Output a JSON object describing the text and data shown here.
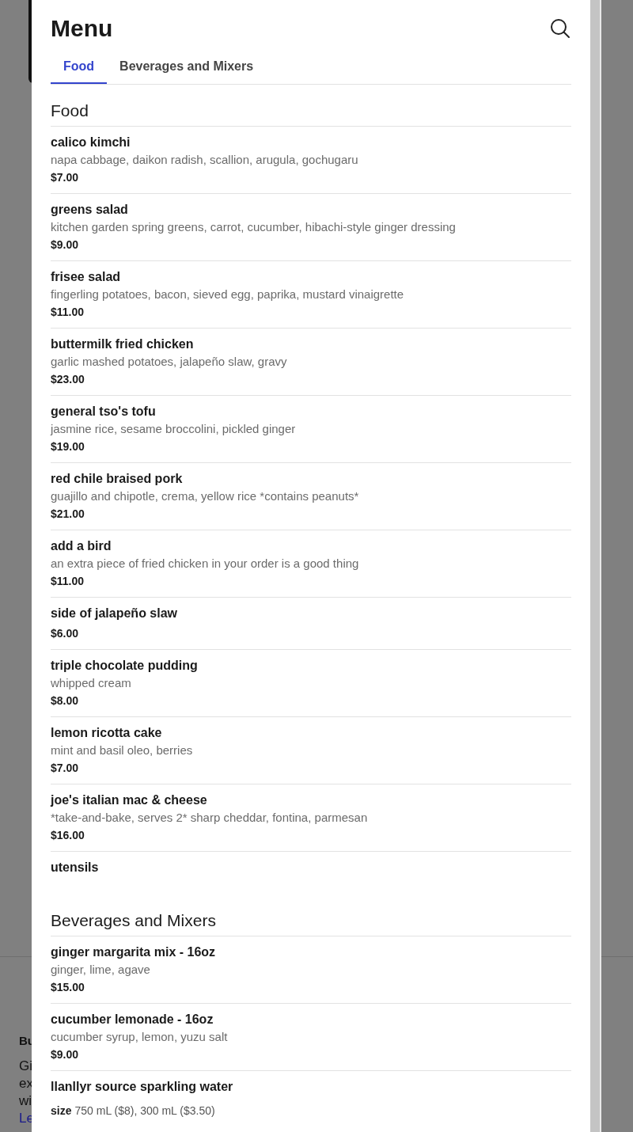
{
  "background": {
    "heading": "Bu",
    "lines": [
      "Gi",
      "ex",
      "wi"
    ],
    "link": "Le"
  },
  "modal": {
    "title": "Menu",
    "tabs": [
      {
        "label": "Food",
        "selected": true
      },
      {
        "label": "Beverages and Mixers",
        "selected": false
      }
    ],
    "sections": [
      {
        "title": "Food",
        "items": [
          {
            "name": "calico kimchi",
            "description": "napa cabbage, daikon radish, scallion, arugula, gochugaru",
            "price": "$7.00"
          },
          {
            "name": "greens salad",
            "description": "kitchen garden spring greens, carrot, cucumber, hibachi-style ginger dressing",
            "price": "$9.00"
          },
          {
            "name": "frisee salad",
            "description": "fingerling potatoes, bacon, sieved egg, paprika, mustard vinaigrette",
            "price": "$11.00"
          },
          {
            "name": "buttermilk fried chicken",
            "description": "garlic mashed potatoes, jalapeño slaw, gravy",
            "price": "$23.00"
          },
          {
            "name": "general tso's tofu",
            "description": "jasmine rice, sesame broccolini, pickled ginger",
            "price": "$19.00"
          },
          {
            "name": "red chile braised pork",
            "description": "guajillo and chipotle, crema, yellow rice *contains peanuts*",
            "price": "$21.00"
          },
          {
            "name": "add a bird",
            "description": "an extra piece of fried chicken in your order is a good thing",
            "price": "$11.00"
          },
          {
            "name": "side of jalapeño slaw",
            "price": "$6.00"
          },
          {
            "name": "triple chocolate pudding",
            "description": "whipped cream",
            "price": "$8.00"
          },
          {
            "name": "lemon ricotta cake",
            "description": "mint and basil oleo, berries",
            "price": "$7.00"
          },
          {
            "name": "joe's italian mac & cheese",
            "description": "*take-and-bake, serves 2* sharp cheddar, fontina, parmesan",
            "price": "$16.00"
          },
          {
            "name": "utensils"
          }
        ]
      },
      {
        "title": "Beverages and Mixers",
        "items": [
          {
            "name": "ginger margarita mix - 16oz",
            "description": "ginger, lime, agave",
            "price": "$15.00"
          },
          {
            "name": "cucumber lemonade - 16oz",
            "description": "cucumber syrup, lemon, yuzu salt",
            "price": "$9.00"
          },
          {
            "name": "llanllyr source sparkling water",
            "option_label": "size",
            "options": "750 mL ($8), 300 mL ($3.50)"
          }
        ]
      }
    ]
  }
}
